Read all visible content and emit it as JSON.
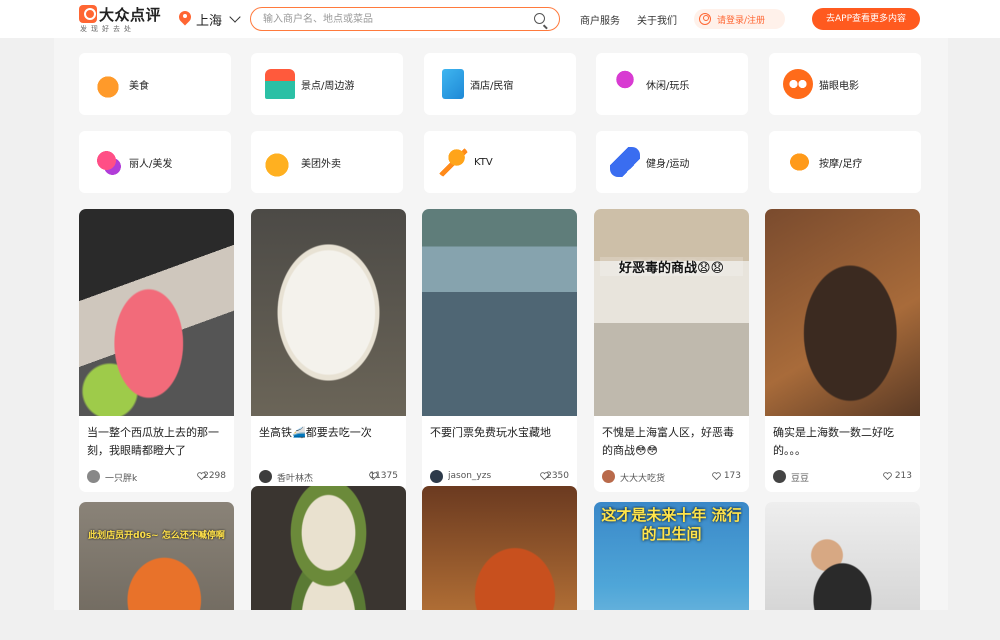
{
  "header": {
    "logo_text": "大众点评",
    "logo_sub": "发现好去处",
    "city": "上海",
    "search_placeholder": "输入商户名、地点或菜品",
    "nav": [
      "商户服务",
      "关于我们"
    ],
    "login_label": "请登录/注册",
    "app_button": "去APP查看更多内容",
    "accent_color": "#ff6633"
  },
  "categories": [
    {
      "label": "美食",
      "icon": "food-icon"
    },
    {
      "label": "景点/周边游",
      "icon": "scenic-icon"
    },
    {
      "label": "酒店/民宿",
      "icon": "hotel-icon"
    },
    {
      "label": "休闲/玩乐",
      "icon": "cocktail-icon"
    },
    {
      "label": "猫眼电影",
      "icon": "maoyan-icon"
    },
    {
      "label": "丽人/美发",
      "icon": "beauty-icon"
    },
    {
      "label": "美团外卖",
      "icon": "delivery-icon"
    },
    {
      "label": "KTV",
      "icon": "microphone-icon"
    },
    {
      "label": "健身/运动",
      "icon": "dumbbell-icon"
    },
    {
      "label": "按摩/足疗",
      "icon": "massage-icon"
    }
  ],
  "posts": [
    {
      "title": "当一整个西瓜放上去的那一刻，我眼睛都瞪大了",
      "author": "一只胖k",
      "likes": "2298"
    },
    {
      "title": "坐高铁🚄都要去吃一次",
      "author": "香叶林杰",
      "likes": "11375"
    },
    {
      "title": "不要门票免费玩水宝藏地",
      "author": "jason_yzs",
      "likes": "2350"
    },
    {
      "title": "不愧是上海富人区，好恶毒的商战😳😳",
      "author": "大大大吃货",
      "likes": "173",
      "overlay": "好恶毒的商战😧😧"
    },
    {
      "title": "确实是上海数一数二好吃的。。。",
      "author": "豆豆",
      "likes": "213"
    }
  ],
  "posts_row2": [
    {
      "overlay": "此划店员开d0s~ 怎么还不喊停啊"
    },
    {},
    {},
    {
      "overlay": "这才是未来十年 流行的卫生间"
    },
    {}
  ]
}
